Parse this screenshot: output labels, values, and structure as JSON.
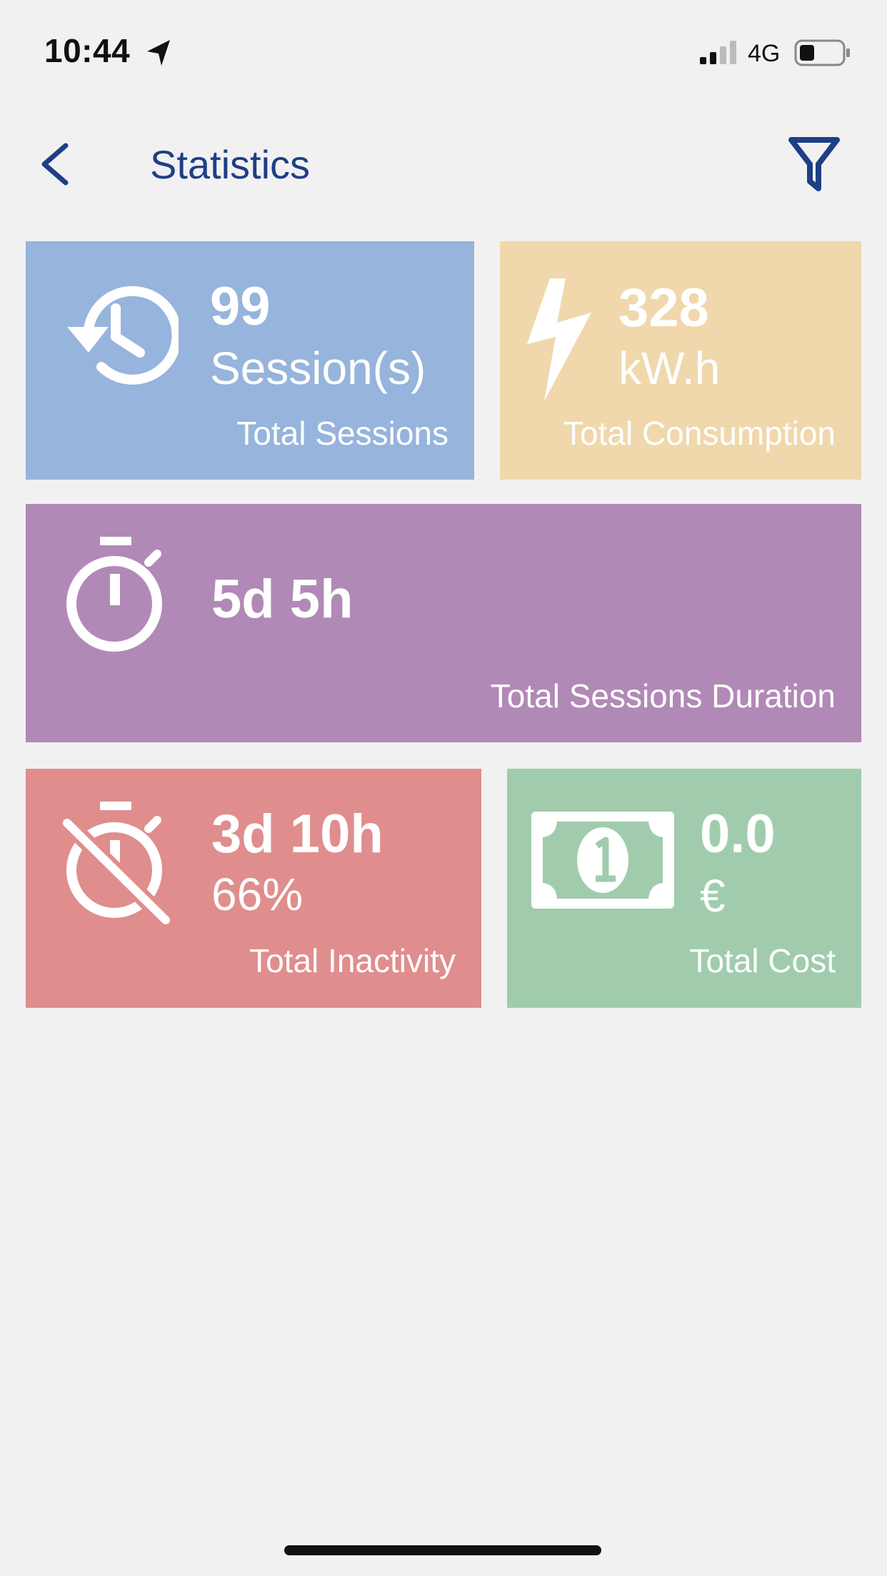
{
  "status_bar": {
    "time": "10:44",
    "network": "4G",
    "icons": [
      "location-arrow-icon",
      "signal-icon",
      "battery-icon"
    ]
  },
  "nav": {
    "title": "Statistics",
    "back_icon": "chevron-left-icon",
    "filter_icon": "filter-icon"
  },
  "colors": {
    "nav_accent": "#1e3f86",
    "background": "#f2f1f2",
    "sessions_tile": "#96b4dc",
    "consumption_tile": "#f0d8ac",
    "duration_tile": "#b189b6",
    "inactivity_tile": "#e08d8d",
    "cost_tile": "#a0ccad"
  },
  "stats": {
    "sessions": {
      "icon": "history-icon",
      "value": "99",
      "unit": "Session(s)",
      "label": "Total Sessions"
    },
    "consumption": {
      "icon": "lightning-bolt-icon",
      "value": "328",
      "unit": "kW.h",
      "label": "Total Consumption"
    },
    "duration": {
      "icon": "stopwatch-icon",
      "value": "5d 5h",
      "label": "Total Sessions Duration"
    },
    "inactivity": {
      "icon": "stopwatch-slash-icon",
      "value": "3d 10h",
      "unit": "66%",
      "label": "Total Inactivity"
    },
    "cost": {
      "icon": "banknote-icon",
      "value": "0.0",
      "unit": "€",
      "label": "Total Cost"
    }
  }
}
